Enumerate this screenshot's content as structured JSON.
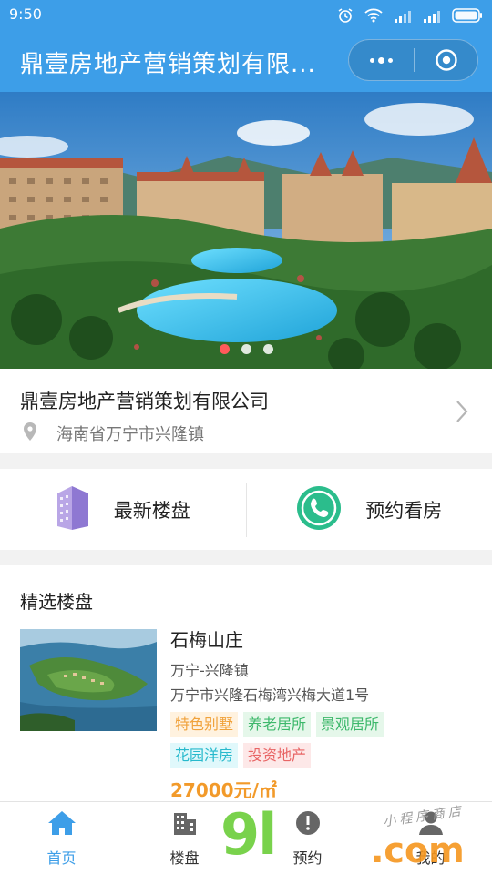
{
  "status": {
    "time": "9:50"
  },
  "nav": {
    "title": "鼎壹房地产营销策划有限..."
  },
  "banner": {
    "slides": 3,
    "active_index": 0
  },
  "company": {
    "name": "鼎壹房地产营销策划有限公司",
    "address": "海南省万宁市兴隆镇"
  },
  "actions": [
    {
      "label": "最新楼盘",
      "icon": "building-icon"
    },
    {
      "label": "预约看房",
      "icon": "phone-icon"
    }
  ],
  "featured": {
    "heading": "精选楼盘",
    "items": [
      {
        "title": "石梅山庄",
        "area": "万宁-兴隆镇",
        "address": "万宁市兴隆石梅湾兴梅大道1号",
        "tags": [
          "特色别墅",
          "养老居所",
          "景观居所",
          "花园洋房",
          "投资地产"
        ],
        "price": "27000元/㎡"
      }
    ]
  },
  "tabbar": [
    {
      "label": "首页",
      "icon": "home-icon",
      "active": true
    },
    {
      "label": "楼盘",
      "icon": "building-icon",
      "active": false
    },
    {
      "label": "预约",
      "icon": "info-icon",
      "active": false
    },
    {
      "label": "我的",
      "icon": "user-icon",
      "active": false
    }
  ],
  "watermark": {
    "big": "9l",
    "com": ".com",
    "small": "小程序商店"
  },
  "colors": {
    "primary": "#3d9ee8",
    "price": "#f29a2a",
    "dot_active": "#ff5a5a"
  }
}
